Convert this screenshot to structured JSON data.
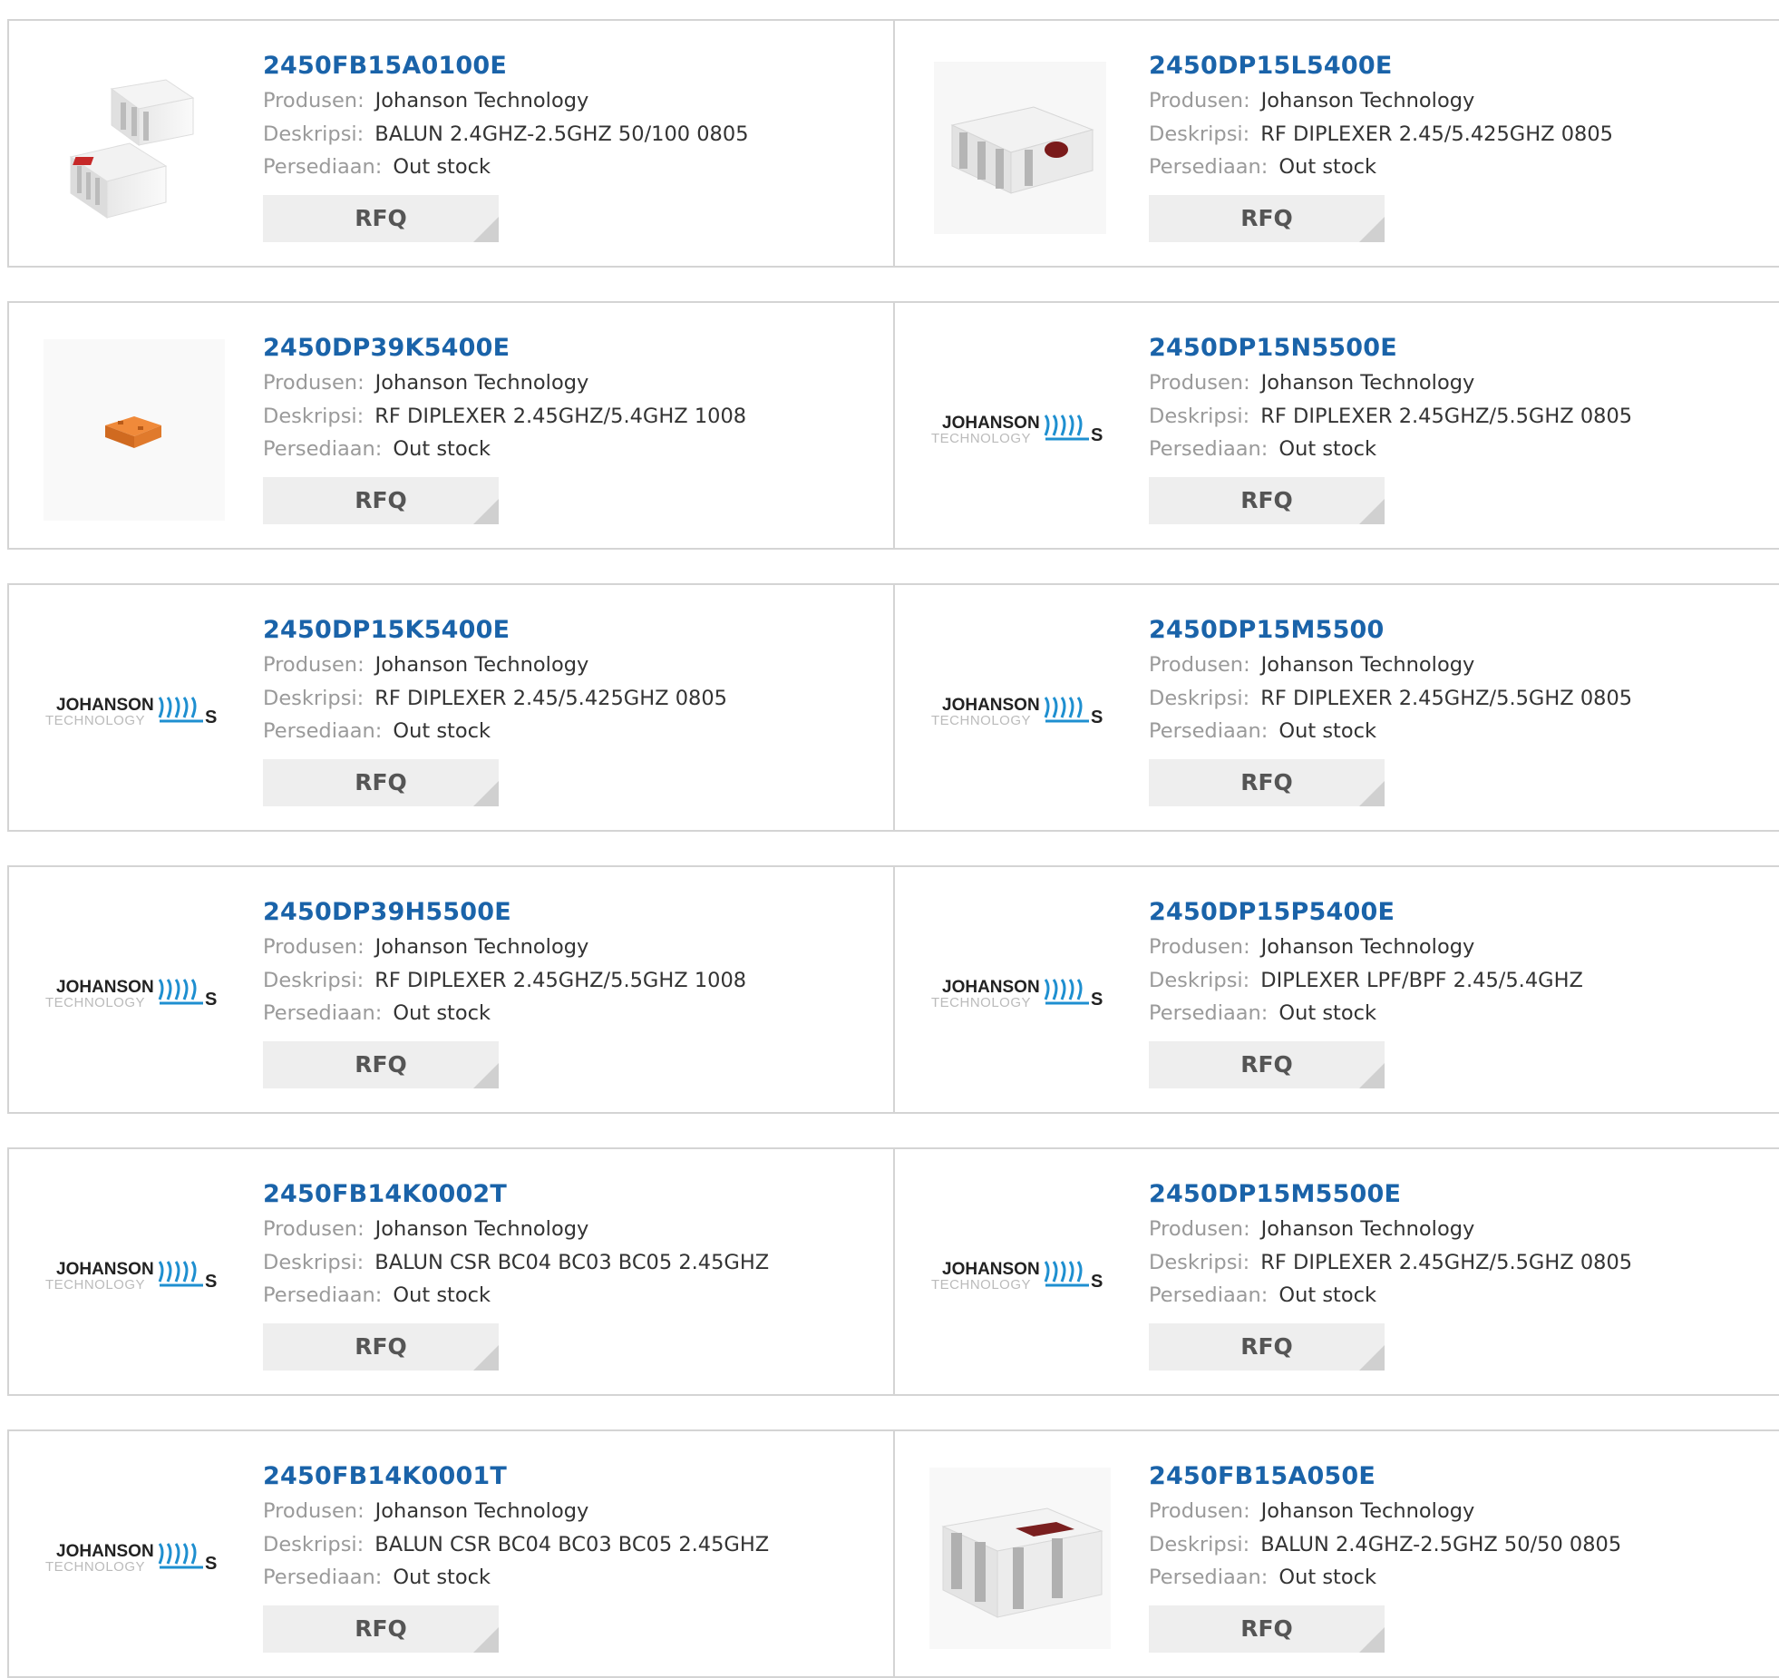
{
  "labels": {
    "manufacturer": "Produsen:",
    "description": "Deskripsi:",
    "stock": "Persediaan:",
    "rfq": "RFQ"
  },
  "colors": {
    "part_link": "#1a63a9",
    "label": "#9a9a9a",
    "value": "#333333",
    "button_bg": "#eeeeee",
    "border": "#d4d4d4"
  },
  "products": [
    {
      "part": "2450FB15A0100E",
      "manufacturer": "Johanson Technology",
      "description": "BALUN 2.4GHZ-2.5GHZ 50/100 0805",
      "stock": "Out stock",
      "image": "balun-chip-stack"
    },
    {
      "part": "2450DP15L5400E",
      "manufacturer": "Johanson Technology",
      "description": "RF DIPLEXER 2.45/5.425GHZ 0805",
      "stock": "Out stock",
      "image": "diplexer-chip-dot"
    },
    {
      "part": "2450DP39K5400E",
      "manufacturer": "Johanson Technology",
      "description": "RF DIPLEXER 2.45GHZ/5.4GHZ 1008",
      "stock": "Out stock",
      "image": "orange-chip"
    },
    {
      "part": "2450DP15N5500E",
      "manufacturer": "Johanson Technology",
      "description": "RF DIPLEXER 2.45GHZ/5.5GHZ 0805",
      "stock": "Out stock",
      "image": "johanson-logo"
    },
    {
      "part": "2450DP15K5400E",
      "manufacturer": "Johanson Technology",
      "description": "RF DIPLEXER 2.45/5.425GHZ 0805",
      "stock": "Out stock",
      "image": "johanson-logo"
    },
    {
      "part": "2450DP15M5500",
      "manufacturer": "Johanson Technology",
      "description": "RF DIPLEXER 2.45GHZ/5.5GHZ 0805",
      "stock": "Out stock",
      "image": "johanson-logo"
    },
    {
      "part": "2450DP39H5500E",
      "manufacturer": "Johanson Technology",
      "description": "RF DIPLEXER 2.45GHZ/5.5GHZ 1008",
      "stock": "Out stock",
      "image": "johanson-logo"
    },
    {
      "part": "2450DP15P5400E",
      "manufacturer": "Johanson Technology",
      "description": "DIPLEXER LPF/BPF 2.45/5.4GHZ",
      "stock": "Out stock",
      "image": "johanson-logo"
    },
    {
      "part": "2450FB14K0002T",
      "manufacturer": "Johanson Technology",
      "description": "BALUN CSR BC04 BC03 BC05 2.45GHZ",
      "stock": "Out stock",
      "image": "johanson-logo"
    },
    {
      "part": "2450DP15M5500E",
      "manufacturer": "Johanson Technology",
      "description": "RF DIPLEXER 2.45GHZ/5.5GHZ 0805",
      "stock": "Out stock",
      "image": "johanson-logo"
    },
    {
      "part": "2450FB14K0001T",
      "manufacturer": "Johanson Technology",
      "description": "BALUN CSR BC04 BC03 BC05 2.45GHZ",
      "stock": "Out stock",
      "image": "johanson-logo"
    },
    {
      "part": "2450FB15A050E",
      "manufacturer": "Johanson Technology",
      "description": "BALUN 2.4GHZ-2.5GHZ 50/50 0805",
      "stock": "Out stock",
      "image": "balun-chip-large"
    }
  ],
  "logo": {
    "line1": "JOHANSON",
    "line2": "TECHNOLOGY"
  }
}
